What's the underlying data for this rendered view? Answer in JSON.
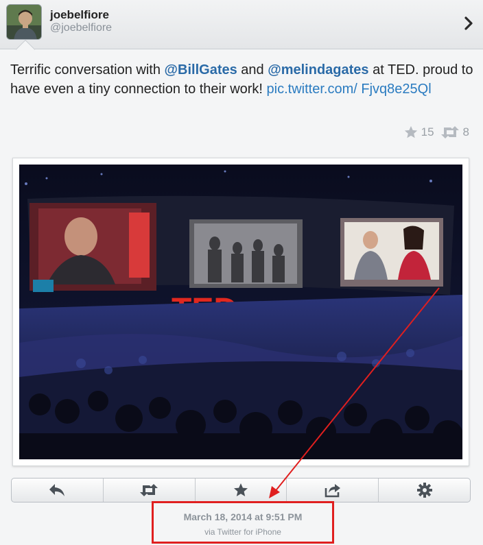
{
  "user": {
    "display_name": "joebelfiore",
    "handle": "@joebelfiore"
  },
  "tweet": {
    "part1": "Terrific conversation with ",
    "mention1": "@BillGates",
    "part2": " and ",
    "mention2": "@melindagates",
    "part3": " at TED. proud to have even a tiny connection to their work! ",
    "link": "pic.twitter.com/ Fjvq8e25Ql"
  },
  "stats": {
    "favorites": "15",
    "retweets": "8"
  },
  "photo": {
    "stage_sign": "TED"
  },
  "actions": [
    {
      "icon": "reply-icon"
    },
    {
      "icon": "retweet-icon"
    },
    {
      "icon": "star-icon"
    },
    {
      "icon": "share-icon"
    },
    {
      "icon": "gear-icon"
    }
  ],
  "meta": {
    "date": "March 18, 2014 at 9:51 PM",
    "via": "via Twitter for iPhone"
  },
  "colors": {
    "mention": "#2a6aa7",
    "link": "#2a7bc0",
    "annotation": "#e01f1f"
  }
}
